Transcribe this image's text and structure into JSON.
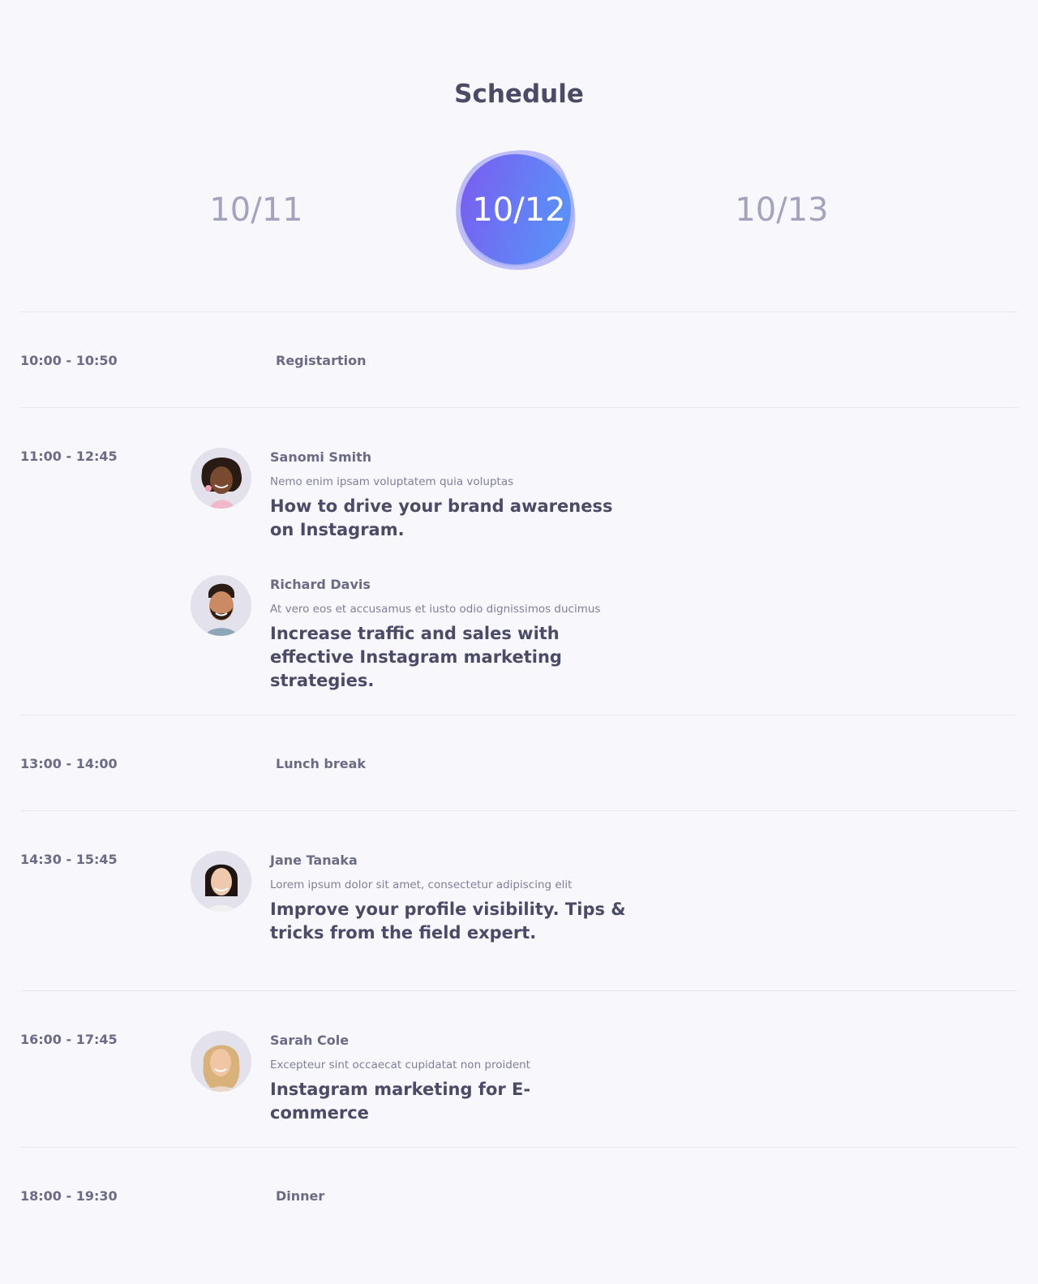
{
  "page": {
    "title": "Schedule"
  },
  "days": {
    "prev": "10/11",
    "active": "10/12",
    "next": "10/13",
    "active_gradient": [
      "#7b5cf0",
      "#5b8ef7"
    ]
  },
  "schedule": [
    {
      "time": "10:00 - 10:50",
      "label": "Registartion"
    },
    {
      "time": "11:00 - 12:45",
      "talks": [
        {
          "speaker": "Sanomi Smith",
          "description": "Nemo enim ipsam voluptatem quia voluptas",
          "title": "How to drive your brand awareness on Instagram."
        },
        {
          "speaker": "Richard Davis",
          "description": "At vero eos et accusamus et iusto odio dignissimos ducimus",
          "title": "Increase traffic and sales with effective Instagram marketing strategies."
        }
      ]
    },
    {
      "time": "13:00 - 14:00",
      "label": "Lunch break"
    },
    {
      "time": "14:30 - 15:45",
      "talks": [
        {
          "speaker": "Jane Tanaka",
          "description": "Lorem ipsum dolor sit amet, consectetur adipiscing elit",
          "title": "Improve your profile visibility. Tips & tricks from the field expert."
        }
      ]
    },
    {
      "time": "16:00 - 17:45",
      "talks": [
        {
          "speaker": "Sarah Cole",
          "description": "Excepteur sint occaecat cupidatat non proident",
          "title": "Instagram marketing for E-commerce"
        }
      ]
    },
    {
      "time": "18:00 - 19:30",
      "label": "Dinner"
    }
  ]
}
